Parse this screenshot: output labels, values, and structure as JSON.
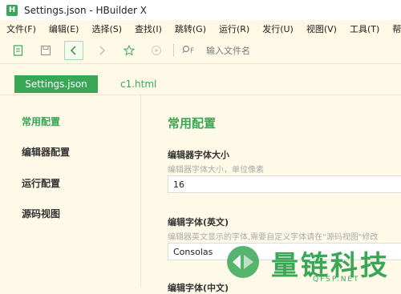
{
  "window": {
    "title": "Settings.json - HBuilder X",
    "logo_letter": "H"
  },
  "menu": [
    "文件(F)",
    "编辑(E)",
    "选择(S)",
    "查找(I)",
    "跳转(G)",
    "运行(R)",
    "发行(U)",
    "视图(V)",
    "工具(T)",
    "帮助("
  ],
  "toolbar": {
    "search_placeholder": "输入文件名",
    "icons": [
      "new-file-icon",
      "save-icon",
      "back-icon",
      "forward-icon",
      "bookmark-icon",
      "run-icon",
      "file-search-icon"
    ],
    "search_icon_glyph": "🔍F"
  },
  "tabs": [
    {
      "label": "Settings.json",
      "active": true
    },
    {
      "label": "c1.html",
      "active": false
    }
  ],
  "nav": [
    {
      "label": "常用配置",
      "active": true
    },
    {
      "label": "编辑器配置",
      "active": false
    },
    {
      "label": "运行配置",
      "active": false
    },
    {
      "label": "源码视图",
      "active": false
    }
  ],
  "content": {
    "section_title": "常用配置",
    "fields": [
      {
        "label": "编辑器字体大小",
        "hint": "编辑器字体大小，单位像素",
        "value": "16"
      },
      {
        "label": "编辑字体(英文)",
        "hint": "编辑器英文显示的字体,需要自定义字体请在\"源码视图\"修改",
        "value": "Consolas"
      },
      {
        "label": "编辑字体(中文)",
        "hint": "",
        "value": ""
      }
    ]
  },
  "watermark": {
    "text": "量链科技",
    "sub": "QFSP.NET"
  },
  "colors": {
    "accent": "#3aa757",
    "background": "#fffae8"
  }
}
